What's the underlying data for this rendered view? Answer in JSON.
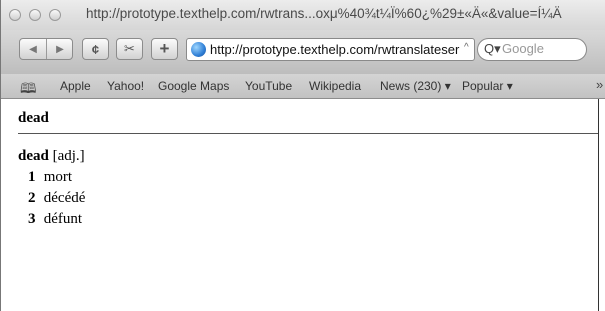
{
  "window": {
    "title": "http://prototype.texthelp.com/rwtrans...oxμ%40¾t¼Ï%60¿%29±«Ä«&value=Í¼Ä"
  },
  "toolbar": {
    "back_icon": "back-arrow-icon",
    "forward_icon": "forward-arrow-icon",
    "reload_glyph": "¢",
    "snip_glyph": "✂",
    "add_glyph": "+",
    "address": "http://prototype.texthelp.com/rwtranslateser",
    "search_placeholder": "Google"
  },
  "bookmarks": {
    "items": [
      {
        "label": "Apple"
      },
      {
        "label": "Yahoo!"
      },
      {
        "label": "Google Maps"
      },
      {
        "label": "YouTube"
      },
      {
        "label": "Wikipedia"
      },
      {
        "label": "News (230) ▾"
      },
      {
        "label": "Popular ▾"
      }
    ]
  },
  "content": {
    "lookup_word": "dead",
    "headword": "dead",
    "part_of_speech": "[adj.]",
    "senses": [
      {
        "num": "1",
        "text": "mort"
      },
      {
        "num": "2",
        "text": "décédé"
      },
      {
        "num": "3",
        "text": "défunt"
      }
    ]
  }
}
